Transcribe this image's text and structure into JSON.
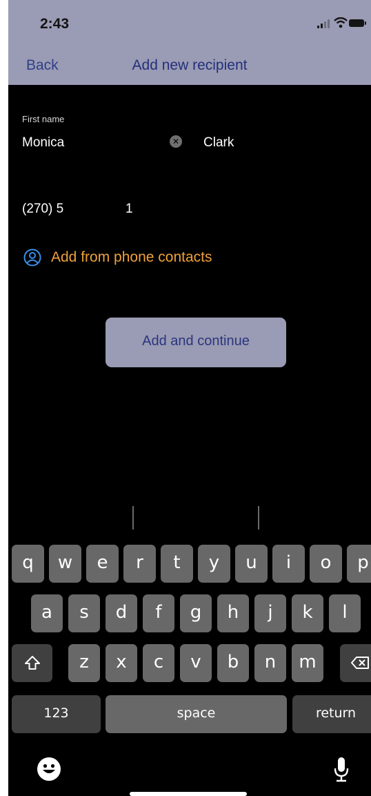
{
  "status": {
    "time": "2:43"
  },
  "nav": {
    "back_label": "Back",
    "title": "Add new recipient"
  },
  "form": {
    "first_name_label": "First name",
    "first_name_value": "Monica",
    "last_name_value": "Clark",
    "phone_value": "(270) 5",
    "phone_suffix": "1"
  },
  "actions": {
    "add_contacts_label": "Add from phone contacts",
    "add_continue_label": "Add and continue"
  },
  "keyboard": {
    "row1": [
      "q",
      "w",
      "e",
      "r",
      "t",
      "y",
      "u",
      "i",
      "o",
      "p"
    ],
    "row2": [
      "a",
      "s",
      "d",
      "f",
      "g",
      "h",
      "j",
      "k",
      "l"
    ],
    "row3": [
      "z",
      "x",
      "c",
      "v",
      "b",
      "n",
      "m"
    ],
    "numbers_label": "123",
    "space_label": "space",
    "return_label": "return"
  },
  "icons": {
    "signal": "signal-icon",
    "wifi": "wifi-icon",
    "battery": "battery-icon",
    "clear": "clear-icon",
    "contacts": "contacts-icon",
    "shift": "shift-icon",
    "delete": "delete-icon",
    "emoji": "emoji-icon",
    "microphone": "microphone-icon"
  },
  "colors": {
    "header_bg": "#9a9bb4",
    "link_accent": "#f0a13a",
    "button_text": "#2a367d"
  }
}
